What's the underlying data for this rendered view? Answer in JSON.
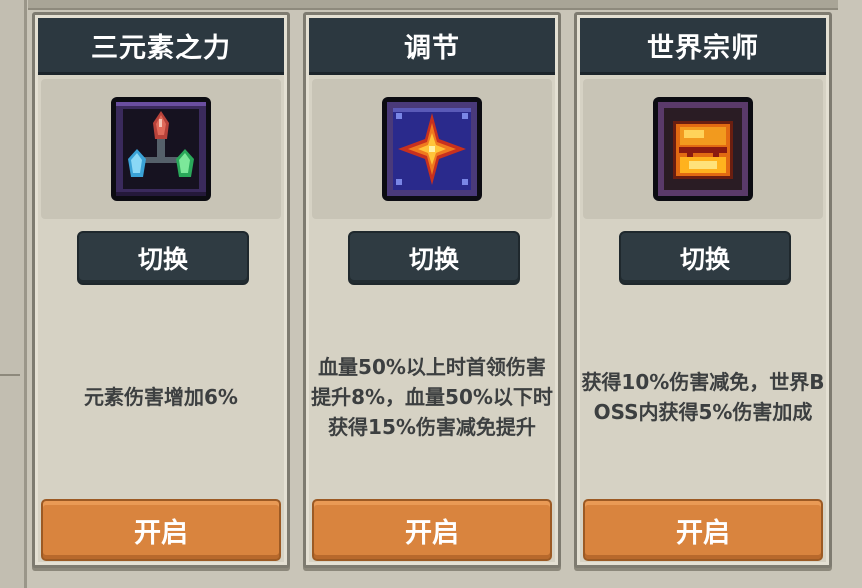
{
  "cards": [
    {
      "title": "三元素之力",
      "icon": "tri-crystal-icon",
      "switch_label": "切换",
      "description": "元素伤害增加6%",
      "open_label": "开启"
    },
    {
      "title": "调节",
      "icon": "radiant-star-icon",
      "switch_label": "切换",
      "description": "血量50%以上时首领伤害提升8%，血量50%以下时获得15%伤害减免提升",
      "open_label": "开启"
    },
    {
      "title": "世界宗师",
      "icon": "golden-chest-icon",
      "switch_label": "切换",
      "description": "获得10%伤害减免，世界BOSS内获得5%伤害加成",
      "open_label": "开启"
    }
  ],
  "colors": {
    "header_bg": "#2c3840",
    "card_bg": "#d6d2c4",
    "open_button": "#d9843e",
    "desc_text": "#3c3f40"
  }
}
